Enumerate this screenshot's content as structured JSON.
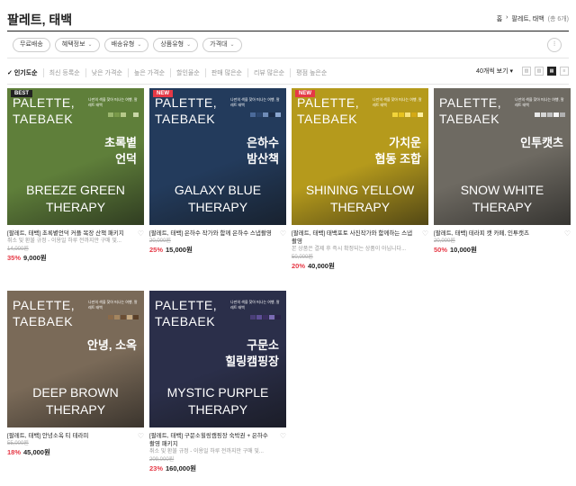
{
  "header": {
    "title": "팔레트, 태백",
    "crumb_home": "홈",
    "crumb_sep": "›",
    "crumb_current": "팔레트, 태백",
    "crumb_count": "(총 6개)"
  },
  "filters": [
    "무료배송",
    "혜택정보",
    "배송유형",
    "상품유형",
    "가격대"
  ],
  "filter_icon": "sliders-icon",
  "sorts": [
    "인기도순",
    "최신 등록순",
    "낮은 가격순",
    "높은 가격순",
    "할인율순",
    "판매 많은순",
    "리뷰 많은순",
    "평점 높은순"
  ],
  "active_sort": "인기도순",
  "per_page": "40개씩 보기 ▾",
  "view_modes": [
    "2",
    "3",
    "4",
    "list"
  ],
  "products": [
    {
      "badge": "BEST",
      "brand1": "PALETTE,",
      "brand2": "TAEBAEK",
      "tagline": "나만의 색을 찾아 떠나는 여행, 팔레트 태백",
      "ko1": "초록볕",
      "ko2": "언덕",
      "en1": "BREEZE GREEN",
      "en2": "THERAPY",
      "title": "[팔레트, 태백] 초록볕언덕 커플 목장 산책 패키지",
      "desc": "취소 및 환불 규정 - 이용일 하루 전까지만 구매 및...",
      "orig": "14,000원",
      "disc": "35%",
      "price": "9,000원",
      "bg": "#5f7f3a",
      "swatches": [
        "#9bb66e",
        "#7a9a4a",
        "#b7c98a",
        "#5f7f3a",
        "#c9d7a6"
      ]
    },
    {
      "badge": "NEW",
      "brand1": "PALETTE,",
      "brand2": "TAEBAEK",
      "tagline": "나만의 색을 찾아 떠나는 여행, 팔레트 태백",
      "ko1": "은하수",
      "ko2": "밤산책",
      "en1": "GALAXY BLUE",
      "en2": "THERAPY",
      "title": "[팔레트, 태백] 은하수 작가와 함께 은하수 스냅촬영",
      "desc": "",
      "orig": "20,000원",
      "disc": "25%",
      "price": "15,000원",
      "bg": "#233b5c",
      "swatches": [
        "#4b6a9a",
        "#2c4770",
        "#6f8cb8",
        "#1b2c48",
        "#8ba6cf"
      ]
    },
    {
      "badge": "NEW",
      "brand1": "PALETTE,",
      "brand2": "TAEBAEK",
      "tagline": "나만의 색을 찾아 떠나는 여행, 팔레트 태백",
      "ko1": "가치운",
      "ko2": "협동 조합",
      "en1": "SHINING YELLOW",
      "en2": "THERAPY",
      "title": "[팔레트, 태백] 태백포토 사진작가와 함께하는 스냅촬영",
      "desc": "본 상품은 결제 후 즉시 확정되는 상품이 아닙니다...",
      "orig": "50,000원",
      "disc": "20%",
      "price": "40,000원",
      "bg": "#b59a1c",
      "swatches": [
        "#f2d43a",
        "#e6c21e",
        "#f7e27a",
        "#d4a914",
        "#fff0a0"
      ]
    },
    {
      "badge": "",
      "brand1": "PALETTE,",
      "brand2": "TAEBAEK",
      "tagline": "나만의 색을 찾아 떠나는 여행, 팔레트 태백",
      "ko1": "인투캣츠",
      "ko2": "",
      "en1": "SNOW WHITE",
      "en2": "THERAPY",
      "title": "[팔레트, 태백] 테라피 캣 카페, 인투캣츠",
      "desc": "",
      "orig": "20,000원",
      "disc": "50%",
      "price": "10,000원",
      "bg": "#6e6a62",
      "swatches": [
        "#e8e8e8",
        "#d6d6d6",
        "#c2c2c2",
        "#f4f4f4",
        "#b0b0b0"
      ]
    },
    {
      "badge": "",
      "brand1": "PALETTE,",
      "brand2": "TAEBAEK",
      "tagline": "나만의 색을 찾아 떠나는 여행, 팔레트 태백",
      "ko1": "안녕, 소옥",
      "ko2": "",
      "en1": "DEEP BROWN",
      "en2": "THERAPY",
      "title": "[팔레트, 태백] 안녕소옥 티 테라피",
      "desc": "",
      "orig": "55,000원",
      "disc": "18%",
      "price": "45,000원",
      "bg": "#7a6a58",
      "swatches": [
        "#8a6a4a",
        "#a4855f",
        "#6b4e34",
        "#c4a77f",
        "#5a3f28"
      ]
    },
    {
      "badge": "",
      "brand1": "PALETTE,",
      "brand2": "TAEBAEK",
      "tagline": "나만의 색을 찾아 떠나는 여행, 팔레트 태백",
      "ko1": "구문소",
      "ko2": "힐링캠핑장",
      "en1": "MYSTIC PURPLE",
      "en2": "THERAPY",
      "title": "[팔레트, 태백] 구문소힐링캠핑장 숙박권 + 은하수 촬영 패키지",
      "desc": "취소 및 환불 규정 - 이용일 하루 전까지만 구매 및...",
      "orig": "209,000원",
      "disc": "23%",
      "price": "160,000원",
      "bg": "#2b2f4a",
      "swatches": [
        "#4a3f78",
        "#5e4f96",
        "#3a2f60",
        "#7a6ab4",
        "#2a2248"
      ]
    }
  ],
  "colors": {
    "discount": "#e63946",
    "best_badge": "#222222",
    "new_badge": "#e63946"
  }
}
